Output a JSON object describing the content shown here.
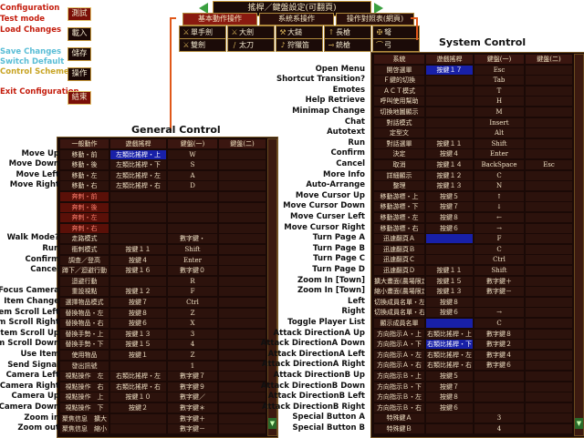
{
  "window": {
    "title": "搖桿／鍵盤設定(可翻頁)"
  },
  "left_menu": [
    {
      "label": "Configuration",
      "color": "red"
    },
    {
      "label": "Test mode",
      "color": "red"
    },
    {
      "label": "Load Changes",
      "color": "red"
    },
    {
      "label": "Save Changes",
      "color": "cyan"
    },
    {
      "label": "Switch Default",
      "color": "cyan"
    },
    {
      "label": "Control Scheme",
      "color": "yellow"
    },
    {
      "label": "Exit Configuration",
      "color": "red"
    }
  ],
  "left_buttons": [
    "測試",
    "載入",
    "儲存",
    "操作",
    "結束"
  ],
  "tabs": [
    "基本動作操作",
    "系統系操作",
    "操作對照表(網頁)"
  ],
  "weapons": [
    {
      "icon": "sword",
      "label": "單手劍"
    },
    {
      "icon": "sword",
      "label": "大劍"
    },
    {
      "icon": "axe",
      "label": "大鎚"
    },
    {
      "icon": "spear",
      "label": "長槍"
    },
    {
      "icon": "crossbow",
      "label": "弩"
    },
    {
      "icon": "dual-swords",
      "label": "雙劍"
    },
    {
      "icon": "longsword",
      "label": "太刀"
    },
    {
      "icon": "horn",
      "label": "狩獵笛"
    },
    {
      "icon": "gunlance",
      "label": "銃槍"
    },
    {
      "icon": "bow",
      "label": "弓"
    }
  ],
  "general": {
    "section_title": "General Control",
    "headers": [
      "一般動作",
      "遊戲搖桿",
      "鍵盤(一)",
      "鍵盤(二)"
    ],
    "rows": [
      {
        "label": "Move Up",
        "cols": [
          "移動・前",
          "左類比搖桿・上",
          "W",
          ""
        ],
        "style": "blue"
      },
      {
        "label": "Move Down",
        "cols": [
          "移動・後",
          "左類比搖桿・下",
          "S",
          ""
        ]
      },
      {
        "label": "Move Left",
        "cols": [
          "移動・左",
          "左類比搖桿・左",
          "A",
          ""
        ]
      },
      {
        "label": "Move Right",
        "cols": [
          "移動・右",
          "左類比搖桿・右",
          "D",
          ""
        ]
      },
      {
        "label": "",
        "cols": [
          "奔刺・前",
          "",
          "",
          ""
        ],
        "style": "sec"
      },
      {
        "label": "",
        "cols": [
          "奔刺・後",
          "",
          "",
          ""
        ],
        "style": "sec"
      },
      {
        "label": "",
        "cols": [
          "奔刺・左",
          "",
          "",
          ""
        ],
        "style": "sec"
      },
      {
        "label": "",
        "cols": [
          "奔刺・右",
          "",
          "",
          ""
        ],
        "style": "sec"
      },
      {
        "label": "Walk Mode?",
        "cols": [
          "走路模式",
          "",
          "數字鍵・",
          ""
        ]
      },
      {
        "label": "Run",
        "cols": [
          "衝刺模式",
          "按鍵１１",
          "Shift",
          ""
        ]
      },
      {
        "label": "Confirm",
        "cols": [
          "調查／登高",
          "按鍵４",
          "Enter",
          ""
        ]
      },
      {
        "label": "Cancel",
        "cols": [
          "蹲下／迴避行動",
          "按鍵１６",
          "數字鍵０",
          ""
        ]
      },
      {
        "label": "",
        "cols": [
          "迴避行動",
          "",
          "R",
          ""
        ]
      },
      {
        "label": "Focus Camera",
        "cols": [
          "重設視點",
          "按鍵１２",
          "F",
          ""
        ]
      },
      {
        "label": "Item Change",
        "cols": [
          "選擇物品模式",
          "按鍵７",
          "Ctrl",
          ""
        ]
      },
      {
        "label": "Item Scroll Left",
        "cols": [
          "替換物品・左",
          "按鍵８",
          "Z",
          ""
        ]
      },
      {
        "label": "Item Scroll Right",
        "cols": [
          "替換物品・右",
          "按鍵６",
          "X",
          ""
        ]
      },
      {
        "label": "Item Scroll Up",
        "cols": [
          "替換手勢・上",
          "按鍵１３",
          "3",
          ""
        ]
      },
      {
        "label": "Item Scroll Down",
        "cols": [
          "替換手勢・下",
          "按鍵１５",
          "4",
          ""
        ]
      },
      {
        "label": "Use Item",
        "cols": [
          "使用物品",
          "按鍵１",
          "Z",
          ""
        ]
      },
      {
        "label": "Send Signal",
        "cols": [
          "發出訊號",
          "",
          "1",
          ""
        ]
      },
      {
        "label": "Camera Left",
        "cols": [
          "視點操作　左",
          "右類比搖桿・左",
          "數字鍵７",
          ""
        ]
      },
      {
        "label": "Camera Right",
        "cols": [
          "視點操作　右",
          "右類比搖桿・右",
          "數字鍵９",
          ""
        ]
      },
      {
        "label": "Camera Up",
        "cols": [
          "視點操作　上",
          "按鍵１０",
          "數字鍵／",
          ""
        ]
      },
      {
        "label": "Camera Down",
        "cols": [
          "視點操作　下",
          "按鍵２",
          "數字鍵＊",
          ""
        ]
      },
      {
        "label": "Zoom in",
        "cols": [
          "聚焦信息　擴大",
          "",
          "數字鍵＋",
          ""
        ]
      },
      {
        "label": "Zoom out",
        "cols": [
          "聚焦信息　縮小",
          "",
          "數字鍵－",
          ""
        ]
      }
    ]
  },
  "system": {
    "section_title": "System Control",
    "headers": [
      "系統",
      "遊戲搖桿",
      "鍵盤(一)",
      "鍵盤(二)"
    ],
    "rows": [
      {
        "label": "Open Menu",
        "cols": [
          "開啓選單",
          "按鍵１７",
          "Esc",
          ""
        ],
        "blue_col": 1
      },
      {
        "label": "Shortcut Transition?",
        "cols": [
          "Ｆ鍵的切換",
          "",
          "Tab",
          ""
        ]
      },
      {
        "label": "Emotes",
        "cols": [
          "ＡＣＴ模式",
          "",
          "T",
          ""
        ]
      },
      {
        "label": "Help Retrieve",
        "cols": [
          "呼叫使用幫助",
          "",
          "H",
          ""
        ]
      },
      {
        "label": "Minimap Change",
        "cols": [
          "切換地圖顯示",
          "",
          "M",
          ""
        ]
      },
      {
        "label": "Chat",
        "cols": [
          "對話模式",
          "",
          "Insert",
          ""
        ]
      },
      {
        "label": "Autotext",
        "cols": [
          "定型文",
          "",
          "Alt",
          ""
        ]
      },
      {
        "label": "Run",
        "cols": [
          "對話選單",
          "按鍵１１",
          "Shift",
          ""
        ]
      },
      {
        "label": "Confirm",
        "cols": [
          "決定",
          "按鍵４",
          "Enter",
          ""
        ]
      },
      {
        "label": "Cancel",
        "cols": [
          "取消",
          "按鍵１４",
          "BackSpace",
          "Esc"
        ]
      },
      {
        "label": "More Info",
        "cols": [
          "詳細顯示",
          "按鍵１２",
          "C",
          ""
        ]
      },
      {
        "label": "Auto-Arrange",
        "cols": [
          "整理",
          "按鍵１３",
          "N",
          ""
        ]
      },
      {
        "label": "Move Cursor Up",
        "cols": [
          "移動游標・上",
          "按鍵５",
          "↑",
          ""
        ]
      },
      {
        "label": "Move Cursor Down",
        "cols": [
          "移動游標・下",
          "按鍵７",
          "↓",
          ""
        ]
      },
      {
        "label": "Move Curser Left",
        "cols": [
          "移動游標・左",
          "按鍵８",
          "←",
          ""
        ]
      },
      {
        "label": "Move Cursor Right",
        "cols": [
          "移動游標・右",
          "按鍵６",
          "→",
          ""
        ]
      },
      {
        "label": "Turn Page A",
        "cols": [
          "迅速翻頁Ａ",
          "",
          "F",
          ""
        ],
        "blue_col": 1
      },
      {
        "label": "Turn Page B",
        "cols": [
          "迅速翻頁Ｂ",
          "",
          "C",
          ""
        ]
      },
      {
        "label": "Turn Page C",
        "cols": [
          "迅速翻頁Ｃ",
          "",
          "Ctrl",
          ""
        ]
      },
      {
        "label": "Turn Page D",
        "cols": [
          "迅速翻頁Ｄ",
          "按鍵１１",
          "Shift",
          ""
        ]
      },
      {
        "label": "Zoom In [Town]",
        "cols": [
          "擴大畫面(農場限定)",
          "按鍵１５",
          "數字鍵＋",
          ""
        ]
      },
      {
        "label": "Zoom In [Town]",
        "cols": [
          "縮小畫面(農場限定)",
          "按鍵１３",
          "數字鍵－",
          ""
        ]
      },
      {
        "label": "Left",
        "cols": [
          "切換成員名單・左",
          "按鍵８",
          "",
          ""
        ]
      },
      {
        "label": "Right",
        "cols": [
          "切換成員名單・右",
          "按鍵６",
          "→",
          ""
        ]
      },
      {
        "label": "Toggle Player List",
        "cols": [
          "顯示成員名單",
          "",
          "C",
          ""
        ],
        "blue_col": 1
      },
      {
        "label": "Attack DirectionA Up",
        "cols": [
          "方向指示Ａ・上",
          "右類比搖桿・上",
          "數字鍵８",
          ""
        ]
      },
      {
        "label": "Attack DirectionA Down",
        "cols": [
          "方向指示Ａ・下",
          "右類比搖桿・下",
          "數字鍵２",
          ""
        ],
        "blue_col": 1
      },
      {
        "label": "Attack DirectionA Left",
        "cols": [
          "方向指示Ａ・左",
          "右類比搖桿・左",
          "數字鍵４",
          ""
        ]
      },
      {
        "label": "Attack DirectionA Right",
        "cols": [
          "方向指示Ａ・右",
          "右類比搖桿・右",
          "數字鍵６",
          ""
        ]
      },
      {
        "label": "Attack DirectionB Up",
        "cols": [
          "方向指示Ｂ・上",
          "按鍵５",
          "",
          ""
        ]
      },
      {
        "label": "Attack DirectionB Down",
        "cols": [
          "方向指示Ｂ・下",
          "按鍵７",
          "",
          ""
        ]
      },
      {
        "label": "Attack DirectionB Left",
        "cols": [
          "方向指示Ｂ・左",
          "按鍵８",
          "",
          ""
        ]
      },
      {
        "label": "Attack DirectionB Right",
        "cols": [
          "方向指示Ｂ・右",
          "按鍵６",
          "",
          ""
        ]
      },
      {
        "label": "Special Button A",
        "cols": [
          "特殊鍵Ａ",
          "",
          "3",
          ""
        ]
      },
      {
        "label": "Special Button B",
        "cols": [
          "特殊鍵Ｂ",
          "",
          "4",
          ""
        ]
      }
    ]
  }
}
